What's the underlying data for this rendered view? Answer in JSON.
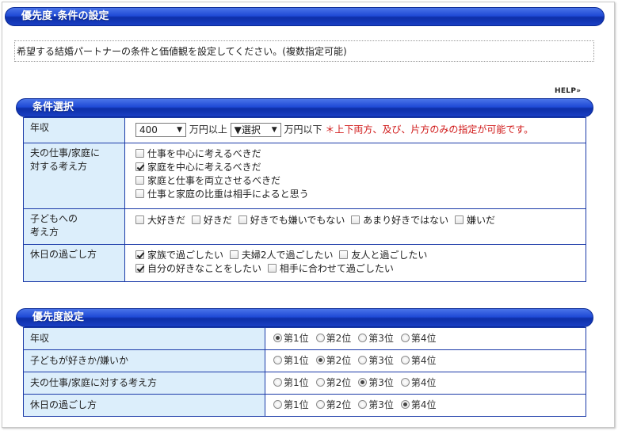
{
  "header": {
    "title": "優先度･条件の設定"
  },
  "intro": {
    "text": "希望する結婚パートナーの条件と価値観を設定してください。(複数指定可能)"
  },
  "help": {
    "label": "HELP",
    "arrow": "»"
  },
  "conditions": {
    "title": "条件選択",
    "income": {
      "label": "年収",
      "min_value": "400",
      "min_suffix": "万円以上",
      "max_value": "▼選択",
      "max_suffix": "万円以下",
      "note": "＊上下両方、及び、片方のみの指定が可能です。"
    },
    "husband_view": {
      "label_line1": "夫の仕事/家庭に",
      "label_line2": "対する考え方",
      "options": [
        {
          "label": "仕事を中心に考えるべきだ",
          "checked": false
        },
        {
          "label": "家庭を中心に考えるべきだ",
          "checked": true
        },
        {
          "label": "家庭と仕事を両立させるべきだ",
          "checked": false
        },
        {
          "label": "仕事と家庭の比重は相手によると思う",
          "checked": false
        }
      ]
    },
    "children_view": {
      "label_line1": "子どもへの",
      "label_line2": "考え方",
      "options": [
        {
          "label": "大好きだ",
          "checked": false
        },
        {
          "label": "好きだ",
          "checked": false
        },
        {
          "label": "好きでも嫌いでもない",
          "checked": false
        },
        {
          "label": "あまり好きではない",
          "checked": false
        },
        {
          "label": "嫌いだ",
          "checked": false
        }
      ]
    },
    "holiday": {
      "label": "休日の過ごし方",
      "options": [
        {
          "label": "家族で過ごしたい",
          "checked": true
        },
        {
          "label": "夫婦2人で過ごしたい",
          "checked": false
        },
        {
          "label": "友人と過ごしたい",
          "checked": false
        },
        {
          "label": "自分の好きなことをしたい",
          "checked": true
        },
        {
          "label": "相手に合わせて過ごしたい",
          "checked": false
        }
      ]
    }
  },
  "priority": {
    "title": "優先度設定",
    "rank_labels": [
      "第1位",
      "第2位",
      "第3位",
      "第4位"
    ],
    "rows": [
      {
        "label": "年収",
        "selected": 0
      },
      {
        "label": "子どもが好きか/嫌いか",
        "selected": 1
      },
      {
        "label": "夫の仕事/家庭に対する考え方",
        "selected": 2
      },
      {
        "label": "休日の過ごし方",
        "selected": 3
      }
    ]
  }
}
